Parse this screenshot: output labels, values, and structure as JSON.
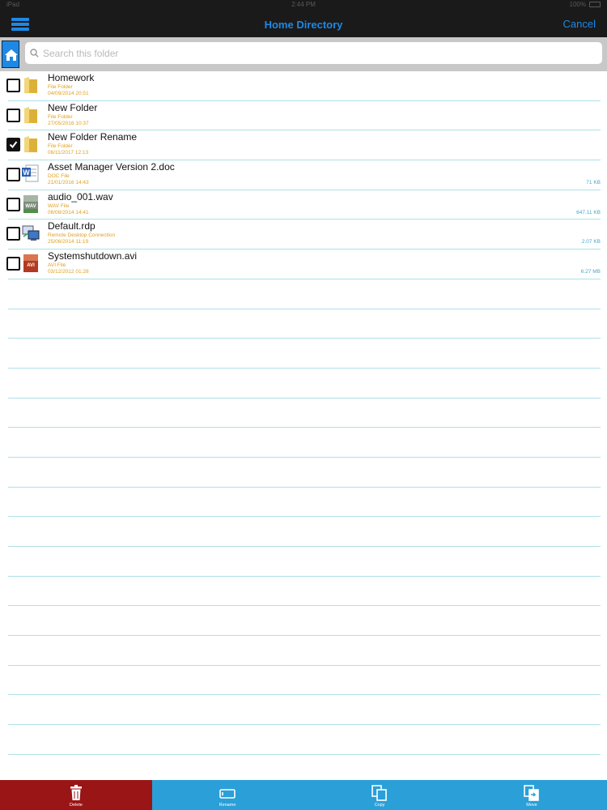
{
  "status_bar": {
    "carrier": "iPad",
    "time": "2:44 PM",
    "battery": "100%"
  },
  "nav": {
    "title": "Home Directory",
    "cancel_label": "Cancel",
    "menu_icon": "hamburger-icon"
  },
  "search": {
    "placeholder": "Search this folder",
    "value": ""
  },
  "files": [
    {
      "name": "Homework",
      "type": "File Folder",
      "date": "04/09/2014 20:51",
      "size": "",
      "checked": false,
      "icon": "folder-icon"
    },
    {
      "name": "New Folder",
      "type": "File Folder",
      "date": "27/05/2016 10:37",
      "size": "",
      "checked": false,
      "icon": "folder-icon"
    },
    {
      "name": "New Folder Rename",
      "type": "File Folder",
      "date": "06/11/2017 12:13",
      "size": "",
      "checked": true,
      "icon": "folder-icon"
    },
    {
      "name": "Asset Manager Version 2.doc",
      "type": "DOC File",
      "date": "21/01/2016 14:43",
      "size": "71 KB",
      "checked": false,
      "icon": "word-doc-icon"
    },
    {
      "name": "audio_001.wav",
      "type": "WAV File",
      "date": "06/08/2014 14:41",
      "size": "647.11 KB",
      "checked": false,
      "icon": "wav-file-icon"
    },
    {
      "name": "Default.rdp",
      "type": "Remote Desktop Connection",
      "date": "25/06/2014 11:19",
      "size": "2.07 KB",
      "checked": false,
      "icon": "rdp-file-icon"
    },
    {
      "name": "Systemshutdown.avi",
      "type": "AVI File",
      "date": "03/12/2012 01:28",
      "size": "6.27 MB",
      "checked": false,
      "icon": "avi-file-icon"
    }
  ],
  "empty_rows": 17,
  "toolbar": {
    "delete_label": "Delete",
    "rename_label": "Rename",
    "copy_label": "Copy",
    "move_label": "Move"
  },
  "colors": {
    "accent": "#1e88e5",
    "delete_bg": "#9a1515",
    "toolbar_bg": "#2a9fd8",
    "meta_text": "#e0a020",
    "size_text": "#4aa6c8",
    "row_divider": "#aee0e8"
  }
}
